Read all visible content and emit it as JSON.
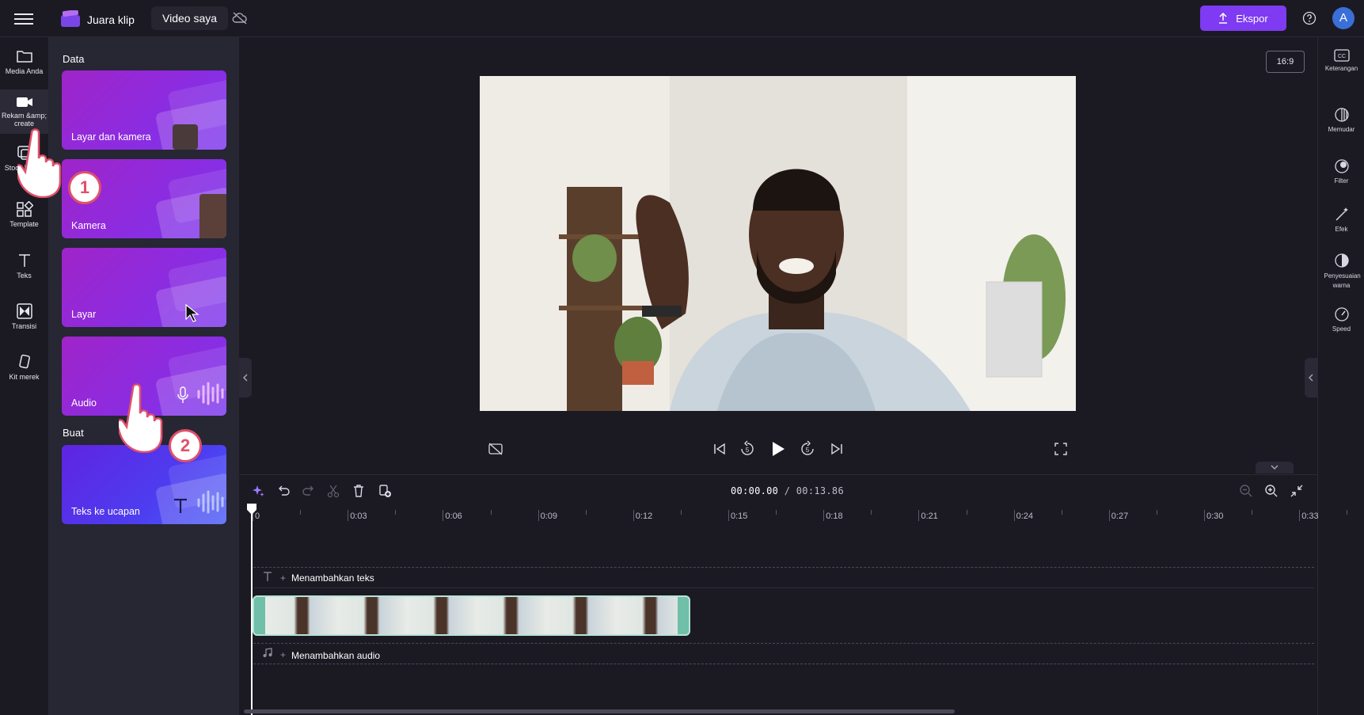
{
  "topbar": {
    "app_title": "Juara klip",
    "tab_label": "Video saya",
    "export_label": "Ekspor",
    "avatar_initial": "A"
  },
  "leftnav": {
    "items": [
      {
        "label": "Media Anda",
        "icon": "folder-icon"
      },
      {
        "label": "Rekam &amp; create",
        "icon": "video-camera-icon"
      },
      {
        "label": "Stock library",
        "icon": "stock-library-icon"
      },
      {
        "label": "Template",
        "icon": "template-icon"
      },
      {
        "label": "Teks",
        "icon": "text-icon"
      },
      {
        "label": "Transisi",
        "icon": "transition-icon"
      },
      {
        "label": "Kit merek",
        "icon": "brand-kit-icon"
      }
    ]
  },
  "panel": {
    "section_data": "Data",
    "section_create": "Buat",
    "cards": [
      {
        "label": "Layar dan kamera"
      },
      {
        "label": "Kamera"
      },
      {
        "label": "Layar"
      },
      {
        "label": "Audio"
      },
      {
        "label": "Teks ke ucapan"
      }
    ]
  },
  "preview": {
    "aspect_ratio": "16:9"
  },
  "rightbar": {
    "items": [
      {
        "label": "Keterangan",
        "icon": "captions-icon"
      },
      {
        "label": "Memudar",
        "icon": "fade-icon"
      },
      {
        "label": "Filter",
        "icon": "filter-icon"
      },
      {
        "label": "Efek",
        "icon": "effects-icon"
      },
      {
        "label": "Penyesuaian warna",
        "icon": "color-adjust-icon"
      },
      {
        "label": "Speed",
        "icon": "speed-icon"
      }
    ]
  },
  "timeline": {
    "current_time": "00:00.00",
    "total_time": "/ 00:13.86",
    "ruler_labels": [
      "0",
      "0:03",
      "0:06",
      "0:09",
      "0:12",
      "0:15",
      "0:18",
      "0:21",
      "0:24",
      "0:27",
      "0:30",
      "0:33"
    ],
    "text_track_label": "Menambahkan teks",
    "audio_track_label": "Menambahkan audio"
  },
  "annotations": {
    "step1": "1",
    "step2": "2"
  },
  "colors": {
    "accent": "#7e3bf2",
    "background": "#1b1a23",
    "panel": "#272633",
    "clip_border": "#b8e3d8",
    "badge": "#e0506a"
  }
}
